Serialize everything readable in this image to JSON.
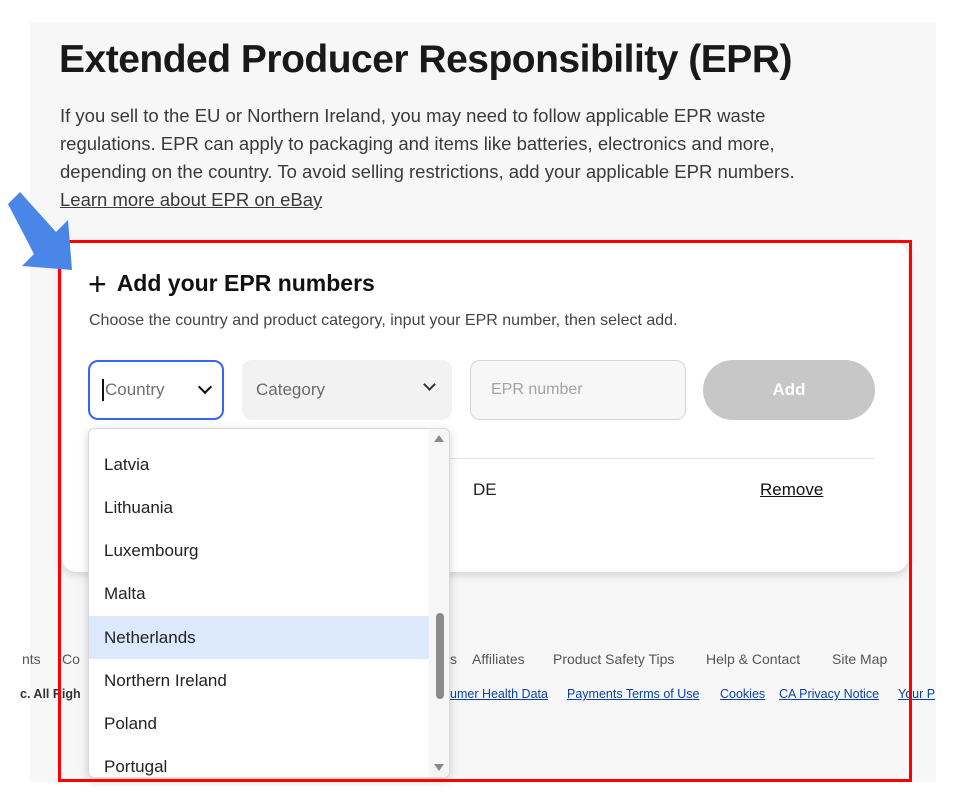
{
  "header": {
    "title": "Extended Producer Responsibility (EPR)",
    "intro_lines": [
      "If you sell to the EU or Northern Ireland, you may need to follow applicable EPR waste",
      "regulations. EPR can apply to packaging and items like batteries, electronics and more,",
      "depending on the country. To avoid selling restrictions, add your applicable EPR numbers."
    ],
    "learn_more": "Learn more about EPR on eBay"
  },
  "form": {
    "title": "Add your EPR numbers",
    "subtitle": "Choose the country and product category, input your EPR number, then select add.",
    "country_placeholder": "Country",
    "category_placeholder": "Category",
    "epr_placeholder": "EPR number",
    "add_label": "Add"
  },
  "entries": [
    {
      "country": "DE",
      "remove_label": "Remove"
    }
  ],
  "dropdown": {
    "options": [
      "Latvia",
      "Lithuania",
      "Luxembourg",
      "Malta",
      "Netherlands",
      "Northern Ireland",
      "Poland",
      "Portugal"
    ],
    "highlighted": "Netherlands"
  },
  "footer": {
    "links": [
      "nts",
      "Co",
      "s",
      "Affiliates",
      "Product Safety Tips",
      "Help & Contact",
      "Site Map"
    ],
    "legal_prefix": "c. All Righ",
    "legal_links": [
      "umer Health Data",
      "Payments Terms of Use",
      "Cookies",
      "CA Privacy Notice",
      "Your P"
    ]
  },
  "colors": {
    "accent": "#3665f3",
    "highlight_box": "#ff0000",
    "arrow": "#4a86e8",
    "selected_option": "#dce8fb",
    "disabled_button": "#c7c7c7"
  }
}
